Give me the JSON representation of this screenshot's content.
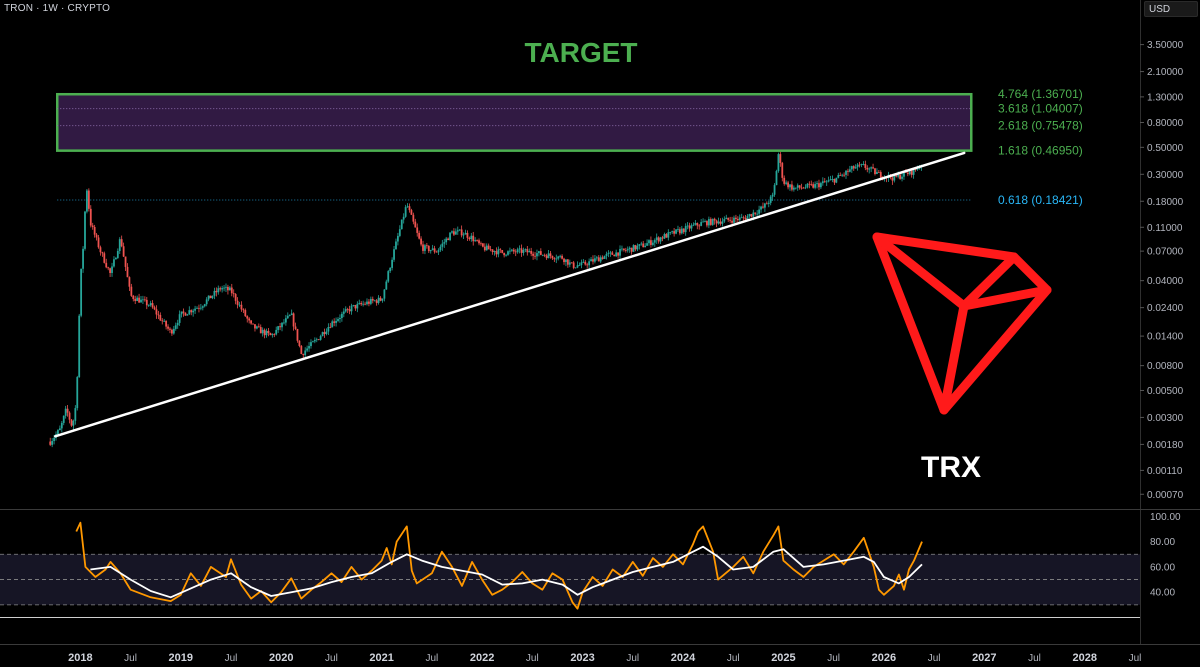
{
  "header": {
    "symbol": "TRON",
    "interval": "1W",
    "exchange": "CRYPTO",
    "separator": " · "
  },
  "currency_button": "USD",
  "target_label": "TARGET",
  "coin_label": "TRX",
  "colors": {
    "background": "#000000",
    "candle_up": "#26a69a",
    "candle_down": "#ef5350",
    "target": "#4caf50",
    "target_fill": "#3a1f4f",
    "fib_blue": "#29b6f6",
    "trendline": "#ffffff",
    "tron_logo": "#ff1a1a",
    "rsi": "#ff9800",
    "rsi_ma": "#ffffff",
    "axis_text": "#b2b5be"
  },
  "chart_data": [
    {
      "type": "candlestick",
      "title": "",
      "y_scale": "log",
      "ylim": [
        0.00055,
        7.0
      ],
      "y_ticks": [
        "3.50000",
        "2.10000",
        "1.30000",
        "0.80000",
        "0.50000",
        "0.30000",
        "0.18000",
        "0.11000",
        "0.07000",
        "0.04000",
        "0.02400",
        "0.01400",
        "0.00800",
        "0.00500",
        "0.00300",
        "0.00180",
        "0.00110",
        "0.00070"
      ],
      "x_ticks": [
        "2018",
        "Jul",
        "2019",
        "Jul",
        "2020",
        "Jul",
        "2021",
        "Jul",
        "2022",
        "Jul",
        "2023",
        "Jul",
        "2024",
        "Jul",
        "2025",
        "Jul",
        "2026",
        "Jul",
        "2027",
        "Jul",
        "2028",
        "Jul"
      ],
      "xlim": [
        2017.2,
        2028.55
      ],
      "price_path": [
        [
          2017.7,
          0.0019
        ],
        [
          2017.8,
          0.0024
        ],
        [
          2017.86,
          0.0035
        ],
        [
          2017.92,
          0.0025
        ],
        [
          2017.96,
          0.004
        ],
        [
          2018.0,
          0.04
        ],
        [
          2018.03,
          0.08
        ],
        [
          2018.06,
          0.25
        ],
        [
          2018.1,
          0.12
        ],
        [
          2018.2,
          0.07
        ],
        [
          2018.3,
          0.045
        ],
        [
          2018.4,
          0.09
        ],
        [
          2018.5,
          0.03
        ],
        [
          2018.7,
          0.025
        ],
        [
          2018.9,
          0.015
        ],
        [
          2019.0,
          0.021
        ],
        [
          2019.2,
          0.025
        ],
        [
          2019.4,
          0.035
        ],
        [
          2019.5,
          0.033
        ],
        [
          2019.7,
          0.017
        ],
        [
          2019.9,
          0.014
        ],
        [
          2020.1,
          0.021
        ],
        [
          2020.2,
          0.01
        ],
        [
          2020.35,
          0.013
        ],
        [
          2020.5,
          0.018
        ],
        [
          2020.7,
          0.024
        ],
        [
          2020.9,
          0.027
        ],
        [
          2021.0,
          0.028
        ],
        [
          2021.1,
          0.06
        ],
        [
          2021.25,
          0.17
        ],
        [
          2021.4,
          0.075
        ],
        [
          2021.55,
          0.07
        ],
        [
          2021.7,
          0.1
        ],
        [
          2021.8,
          0.1
        ],
        [
          2021.9,
          0.09
        ],
        [
          2022.0,
          0.075
        ],
        [
          2022.2,
          0.068
        ],
        [
          2022.4,
          0.07
        ],
        [
          2022.6,
          0.066
        ],
        [
          2022.8,
          0.062
        ],
        [
          2022.9,
          0.053
        ],
        [
          2023.0,
          0.054
        ],
        [
          2023.2,
          0.063
        ],
        [
          2023.4,
          0.07
        ],
        [
          2023.6,
          0.078
        ],
        [
          2023.8,
          0.092
        ],
        [
          2024.0,
          0.105
        ],
        [
          2024.2,
          0.12
        ],
        [
          2024.4,
          0.125
        ],
        [
          2024.6,
          0.13
        ],
        [
          2024.8,
          0.16
        ],
        [
          2024.9,
          0.2
        ],
        [
          2024.95,
          0.44
        ],
        [
          2025.0,
          0.26
        ],
        [
          2025.1,
          0.23
        ],
        [
          2025.3,
          0.24
        ],
        [
          2025.5,
          0.27
        ],
        [
          2025.6,
          0.3
        ],
        [
          2025.7,
          0.34
        ],
        [
          2025.8,
          0.35
        ],
        [
          2025.95,
          0.3
        ],
        [
          2026.1,
          0.28
        ],
        [
          2026.3,
          0.32
        ],
        [
          2026.38,
          0.37
        ]
      ],
      "trendline": {
        "from": [
          2017.75,
          0.0021
        ],
        "to": [
          2026.8,
          0.45
        ]
      },
      "target_zone": {
        "label": "TARGET",
        "from": 0.4695,
        "to": 1.36701,
        "x_from": 2017.77,
        "x_to": 2026.87
      },
      "fib_levels": [
        {
          "label": "4.764 (1.36701)",
          "value": 1.36701,
          "color": "#4caf50"
        },
        {
          "label": "3.618 (1.04007)",
          "value": 1.04007,
          "color": "#4caf50"
        },
        {
          "label": "2.618 (0.75478)",
          "value": 0.75478,
          "color": "#4caf50"
        },
        {
          "label": "1.618 (0.46950)",
          "value": 0.4695,
          "color": "#4caf50"
        },
        {
          "label": "0.618 (0.18421)",
          "value": 0.18421,
          "color": "#29b6f6"
        }
      ]
    },
    {
      "type": "line",
      "title": "",
      "ylim": [
        22,
        105
      ],
      "y_ticks": [
        "100.00",
        "80.00",
        "60.00",
        "40.00"
      ],
      "bands": {
        "upper": 70,
        "middle": 50,
        "lower": 30
      },
      "rsi": [
        [
          2017.96,
          88
        ],
        [
          2018.0,
          95
        ],
        [
          2018.05,
          60
        ],
        [
          2018.15,
          52
        ],
        [
          2018.25,
          58
        ],
        [
          2018.3,
          64
        ],
        [
          2018.4,
          55
        ],
        [
          2018.5,
          42
        ],
        [
          2018.7,
          36
        ],
        [
          2018.9,
          33
        ],
        [
          2019.0,
          38
        ],
        [
          2019.1,
          55
        ],
        [
          2019.2,
          45
        ],
        [
          2019.3,
          60
        ],
        [
          2019.45,
          52
        ],
        [
          2019.5,
          66
        ],
        [
          2019.6,
          46
        ],
        [
          2019.7,
          35
        ],
        [
          2019.8,
          41
        ],
        [
          2019.9,
          32
        ],
        [
          2020.0,
          40
        ],
        [
          2020.1,
          51
        ],
        [
          2020.2,
          35
        ],
        [
          2020.3,
          42
        ],
        [
          2020.4,
          48
        ],
        [
          2020.5,
          55
        ],
        [
          2020.6,
          48
        ],
        [
          2020.7,
          60
        ],
        [
          2020.8,
          50
        ],
        [
          2020.9,
          57
        ],
        [
          2021.0,
          65
        ],
        [
          2021.05,
          75
        ],
        [
          2021.1,
          62
        ],
        [
          2021.15,
          80
        ],
        [
          2021.25,
          92
        ],
        [
          2021.3,
          57
        ],
        [
          2021.35,
          47
        ],
        [
          2021.5,
          55
        ],
        [
          2021.6,
          72
        ],
        [
          2021.7,
          60
        ],
        [
          2021.8,
          45
        ],
        [
          2021.9,
          64
        ],
        [
          2022.0,
          50
        ],
        [
          2022.1,
          38
        ],
        [
          2022.2,
          42
        ],
        [
          2022.3,
          48
        ],
        [
          2022.4,
          56
        ],
        [
          2022.5,
          47
        ],
        [
          2022.6,
          42
        ],
        [
          2022.7,
          55
        ],
        [
          2022.8,
          50
        ],
        [
          2022.9,
          32
        ],
        [
          2022.95,
          27
        ],
        [
          2023.0,
          40
        ],
        [
          2023.1,
          52
        ],
        [
          2023.2,
          45
        ],
        [
          2023.3,
          58
        ],
        [
          2023.4,
          52
        ],
        [
          2023.5,
          64
        ],
        [
          2023.6,
          53
        ],
        [
          2023.7,
          67
        ],
        [
          2023.8,
          60
        ],
        [
          2023.9,
          70
        ],
        [
          2024.0,
          62
        ],
        [
          2024.1,
          78
        ],
        [
          2024.15,
          88
        ],
        [
          2024.2,
          92
        ],
        [
          2024.3,
          72
        ],
        [
          2024.35,
          50
        ],
        [
          2024.5,
          60
        ],
        [
          2024.6,
          68
        ],
        [
          2024.7,
          55
        ],
        [
          2024.8,
          72
        ],
        [
          2024.9,
          85
        ],
        [
          2024.95,
          92
        ],
        [
          2025.0,
          65
        ],
        [
          2025.1,
          58
        ],
        [
          2025.2,
          52
        ],
        [
          2025.3,
          60
        ],
        [
          2025.4,
          65
        ],
        [
          2025.5,
          70
        ],
        [
          2025.6,
          62
        ],
        [
          2025.7,
          72
        ],
        [
          2025.8,
          83
        ],
        [
          2025.9,
          60
        ],
        [
          2025.95,
          42
        ],
        [
          2026.0,
          38
        ],
        [
          2026.1,
          45
        ],
        [
          2026.15,
          54
        ],
        [
          2026.2,
          42
        ],
        [
          2026.25,
          58
        ],
        [
          2026.3,
          65
        ],
        [
          2026.38,
          80
        ]
      ],
      "rsi_ma": [
        [
          2018.1,
          58
        ],
        [
          2018.3,
          60
        ],
        [
          2018.5,
          50
        ],
        [
          2018.7,
          41
        ],
        [
          2018.9,
          36
        ],
        [
          2019.1,
          43
        ],
        [
          2019.3,
          50
        ],
        [
          2019.5,
          55
        ],
        [
          2019.7,
          44
        ],
        [
          2019.9,
          37
        ],
        [
          2020.1,
          40
        ],
        [
          2020.3,
          43
        ],
        [
          2020.5,
          48
        ],
        [
          2020.7,
          52
        ],
        [
          2020.9,
          55
        ],
        [
          2021.1,
          64
        ],
        [
          2021.25,
          70
        ],
        [
          2021.4,
          65
        ],
        [
          2021.6,
          60
        ],
        [
          2021.8,
          57
        ],
        [
          2022.0,
          54
        ],
        [
          2022.2,
          46
        ],
        [
          2022.4,
          47
        ],
        [
          2022.6,
          50
        ],
        [
          2022.8,
          46
        ],
        [
          2022.95,
          38
        ],
        [
          2023.1,
          44
        ],
        [
          2023.3,
          50
        ],
        [
          2023.5,
          56
        ],
        [
          2023.7,
          60
        ],
        [
          2023.9,
          64
        ],
        [
          2024.1,
          72
        ],
        [
          2024.2,
          76
        ],
        [
          2024.35,
          68
        ],
        [
          2024.5,
          58
        ],
        [
          2024.7,
          60
        ],
        [
          2024.9,
          72
        ],
        [
          2025.0,
          74
        ],
        [
          2025.2,
          60
        ],
        [
          2025.4,
          62
        ],
        [
          2025.6,
          65
        ],
        [
          2025.8,
          68
        ],
        [
          2025.9,
          64
        ],
        [
          2026.0,
          52
        ],
        [
          2026.15,
          47
        ],
        [
          2026.25,
          52
        ],
        [
          2026.38,
          62
        ]
      ]
    }
  ]
}
